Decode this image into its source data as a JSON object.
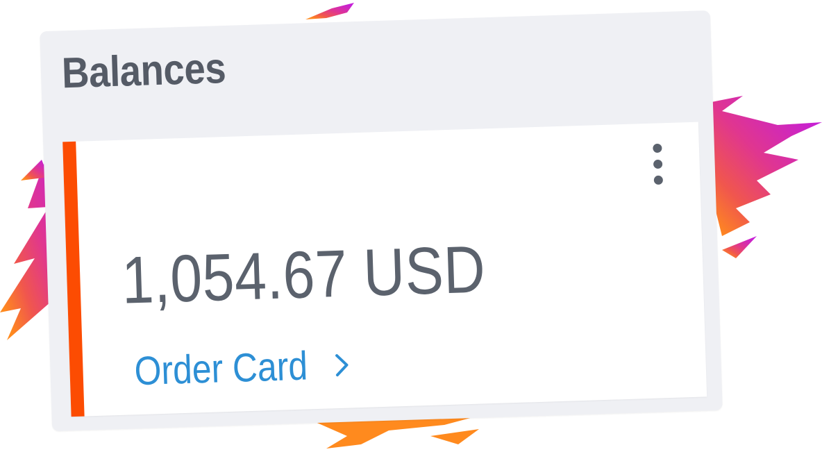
{
  "panel": {
    "title": "Balances"
  },
  "balance_card": {
    "amount": "1,054.67 USD",
    "accent_color": "#fc4c02",
    "menu_icon": "more-vertical-icon",
    "action": {
      "label": "Order Card",
      "icon": "chevron-right-icon",
      "color": "#2d8fd5"
    }
  }
}
